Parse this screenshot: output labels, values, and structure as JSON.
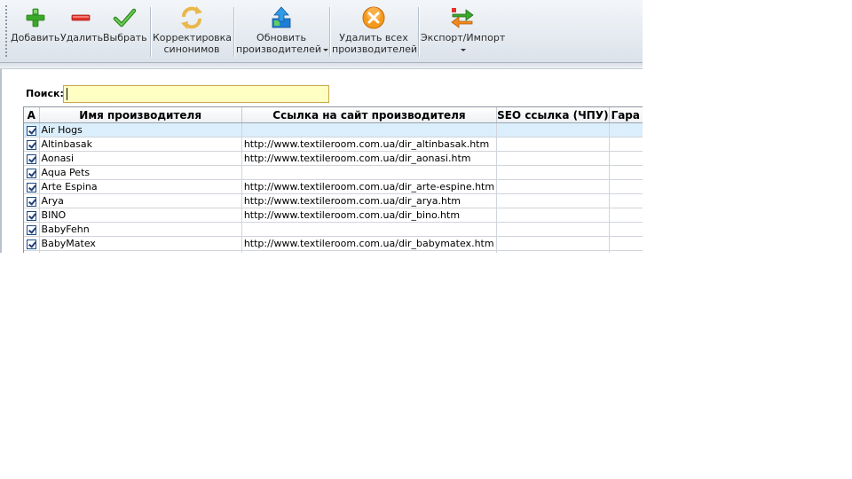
{
  "toolbar": {
    "add": "Добавить",
    "delete": "Удалить",
    "select": "Выбрать",
    "synonyms_line1": "Корректировка",
    "synonyms_line2": "синонимов",
    "update_line1": "Обновить",
    "update_line2": "производителей",
    "delete_all_line1": "Удалить всех",
    "delete_all_line2": "производителей",
    "export_import": "Экспорт/Импорт"
  },
  "search": {
    "label": "Поиск:",
    "value": ""
  },
  "grid": {
    "columns": [
      "А",
      "Имя производителя",
      "Ссылка на сайт производителя",
      "SEO ссылка (ЧПУ)",
      "Гара"
    ],
    "rows": [
      {
        "name": "Air Hogs",
        "url": "",
        "checked": true
      },
      {
        "name": "Altinbasak",
        "url": "http://www.textileroom.com.ua/dir_altinbasak.htm",
        "checked": true
      },
      {
        "name": "Aonasi",
        "url": "http://www.textileroom.com.ua/dir_aonasi.htm",
        "checked": true
      },
      {
        "name": "Aqua Pets",
        "url": "",
        "checked": true
      },
      {
        "name": "Arte Espina",
        "url": "http://www.textileroom.com.ua/dir_arte-espine.htm",
        "checked": true
      },
      {
        "name": "Arya",
        "url": "http://www.textileroom.com.ua/dir_arya.htm",
        "checked": true
      },
      {
        "name": "BINO",
        "url": "http://www.textileroom.com.ua/dir_bino.htm",
        "checked": true
      },
      {
        "name": "BabyFehn",
        "url": "",
        "checked": true
      },
      {
        "name": "BabyMatex",
        "url": "http://www.textileroom.com.ua/dir_babymatex.htm",
        "checked": true
      }
    ]
  }
}
